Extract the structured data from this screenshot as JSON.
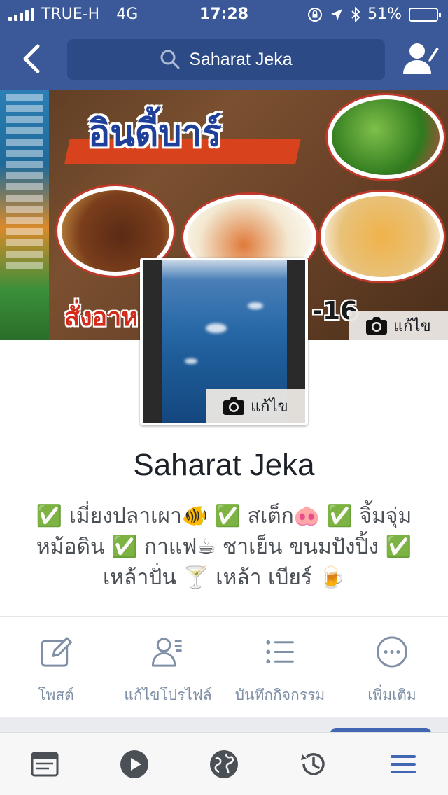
{
  "status_bar": {
    "carrier": "TRUE-H",
    "network": "4G",
    "time": "17:28",
    "battery_percent": "51%",
    "battery_level": 0.51
  },
  "nav": {
    "search_text": "Saharat Jeka",
    "header_color": "#3b5998"
  },
  "cover": {
    "edit_label": "แก้ไข",
    "brand_text": "อินดี้บาร์",
    "order_text": "สั่งอาห",
    "phone_text": "-16"
  },
  "profile_photo": {
    "edit_label": "แก้ไข"
  },
  "profile": {
    "name": "Saharat Jeka",
    "bio_line1": "✅ เมี่ยงปลาเผา🐠 ✅ สเต็ก🐽 ✅ จิ้มจุ่ม",
    "bio_line2": "หม้อดิน ✅ กาแฟ☕ ชาเย็น ขนมปังปิ้ง ✅",
    "bio_line3": "เหล้าปั่น 🍸 เหล้า เบียร์ 🍺"
  },
  "actions": [
    {
      "label": "โพสต์",
      "icon": "compose-icon"
    },
    {
      "label": "แก้ไขโปรไฟล์",
      "icon": "edit-profile-icon"
    },
    {
      "label": "บันทึกกิจกรรม",
      "icon": "activity-log-icon"
    },
    {
      "label": "เพิ่มเติม",
      "icon": "more-icon"
    }
  ],
  "tabbar": [
    {
      "icon": "news-feed-icon"
    },
    {
      "icon": "video-icon"
    },
    {
      "icon": "globe-icon"
    },
    {
      "icon": "history-icon"
    },
    {
      "icon": "menu-icon",
      "active": true
    }
  ],
  "colors": {
    "accent": "#3b5998",
    "active_tab": "#4267b2",
    "inactive_icon": "#4b4f56",
    "action_icon": "#7f8fa6"
  }
}
